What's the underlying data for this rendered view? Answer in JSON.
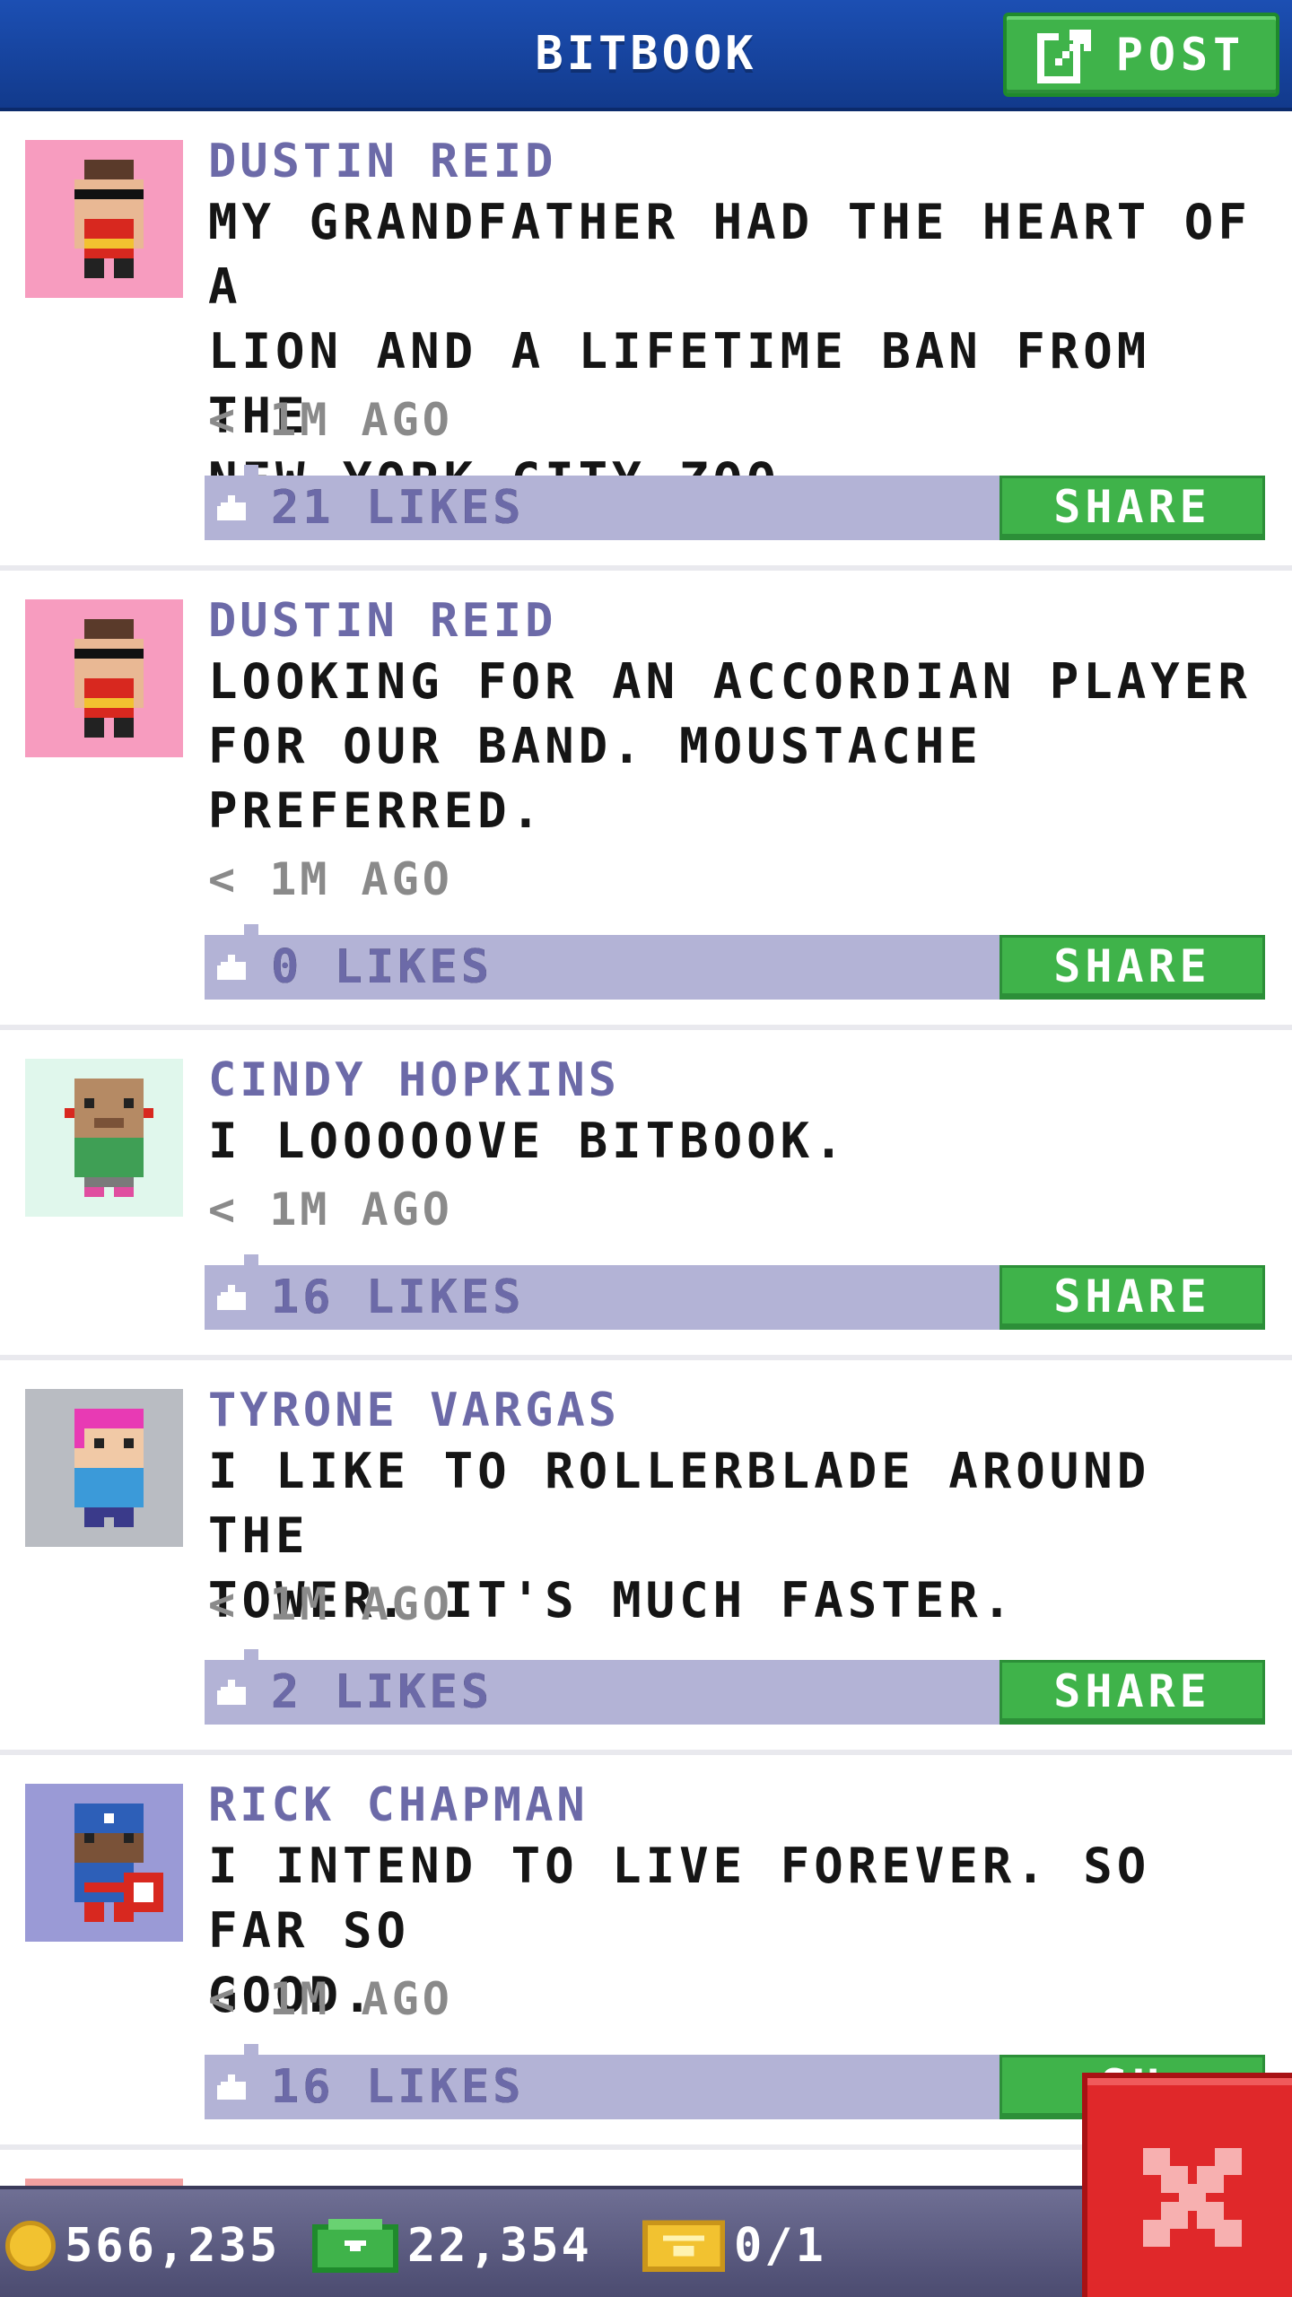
{
  "header": {
    "title": "BITBOOK",
    "post_label": "POST",
    "post_icon": "edit-icon"
  },
  "posts": [
    {
      "author": "DUSTIN REID",
      "message": "MY GRANDFATHER HAD THE HEART OF A\nLION AND A LIFETIME BAN FROM THE\nNEW YORK CITY ZOO.",
      "time": "< 1M AGO",
      "likes": "21 LIKES",
      "share": "SHARE",
      "avatar": "bandit-avatar",
      "avatar_bg": "#f79cbf"
    },
    {
      "author": "DUSTIN REID",
      "message": "LOOKING FOR AN ACCORDIAN PLAYER\nFOR OUR BAND. MOUSTACHE\nPREFERRED.",
      "time": "< 1M AGO",
      "likes": "0 LIKES",
      "share": "SHARE",
      "avatar": "bandit-avatar",
      "avatar_bg": "#f79cbf"
    },
    {
      "author": "CINDY HOPKINS",
      "message": "I LOOOOOVE BITBOOK.",
      "time": "< 1M AGO",
      "likes": "16 LIKES",
      "share": "SHARE",
      "avatar": "bald-avatar",
      "avatar_bg": "#e0f7ec"
    },
    {
      "author": "TYRONE VARGAS",
      "message": "I LIKE TO ROLLERBLADE AROUND THE\nTOWER. IT'S MUCH FASTER.",
      "time": "< 1M AGO",
      "likes": "2 LIKES",
      "share": "SHARE",
      "avatar": "pink-hair-avatar",
      "avatar_bg": "#b9bcc2"
    },
    {
      "author": "RICK CHAPMAN",
      "message": "I INTEND TO LIVE FOREVER. SO FAR SO\nGOOD.",
      "time": "< 1M AGO",
      "likes": "16 LIKES",
      "share": "SH",
      "avatar": "captain-avatar",
      "avatar_bg": "#9a9ad6"
    }
  ],
  "footer": {
    "coins": "566,235",
    "bux": "22,354",
    "tickets": "0/1"
  },
  "colors": {
    "header": "#1c4fb3",
    "accent_green": "#3fb34a",
    "likes_bar": "#b3b3d6",
    "author_text": "#6c6aa8",
    "close_red": "#e0282a"
  }
}
